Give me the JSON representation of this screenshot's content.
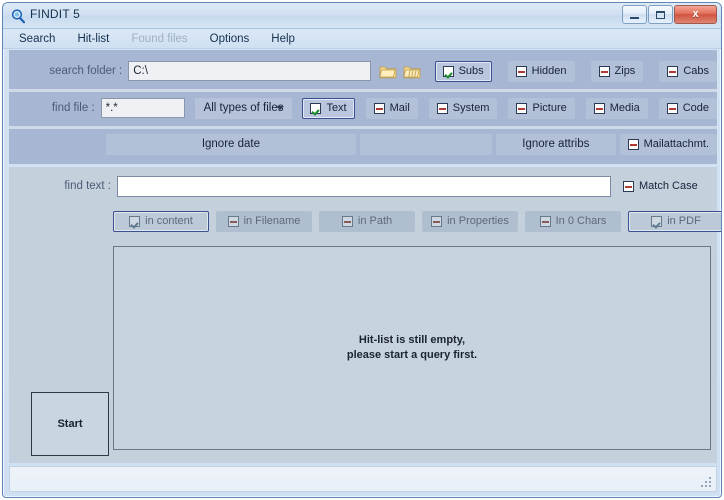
{
  "window": {
    "title": "FINDIT  5",
    "icon": "magnifier-icon",
    "minimize_label": "",
    "maximize_label": "",
    "close_label": "x"
  },
  "menubar": {
    "items": [
      {
        "label": "Search",
        "disabled": false
      },
      {
        "label": "Hit-list",
        "disabled": false
      },
      {
        "label": "Found files",
        "disabled": true
      },
      {
        "label": "Options",
        "disabled": false
      },
      {
        "label": "Help",
        "disabled": false
      }
    ]
  },
  "search_folder_row": {
    "label": "search folder :",
    "value": "C:\\",
    "placeholder": "",
    "browse_folder_icon": "folder-icon",
    "browse_folders_icon": "multi-folder-icon",
    "options": [
      {
        "label": "Subs",
        "checked": true
      },
      {
        "label": "Hidden",
        "checked": false
      },
      {
        "label": "Zips",
        "checked": false
      },
      {
        "label": "Cabs",
        "checked": false
      }
    ]
  },
  "find_file_row": {
    "label": "find file :",
    "value": "*.*",
    "placeholder": "",
    "filetype_selected": "All types of files",
    "options": [
      {
        "label": "Text",
        "checked": true
      },
      {
        "label": "Mail",
        "checked": false
      },
      {
        "label": "System",
        "checked": false
      },
      {
        "label": "Picture",
        "checked": false
      },
      {
        "label": "Media",
        "checked": false
      },
      {
        "label": "Code",
        "checked": false
      }
    ]
  },
  "ignore_row": {
    "ignore_date_label": "Ignore date",
    "ignore_attribs_label": "Ignore attribs",
    "mailattachment": {
      "label": "Mailattachmt.",
      "checked": false
    }
  },
  "find_text_row": {
    "label": "find text :",
    "value": "",
    "placeholder": "",
    "match_case": {
      "label": "Match Case",
      "checked": false
    }
  },
  "scope_buttons": [
    {
      "label": "in content",
      "checked": true
    },
    {
      "label": "in Filename",
      "checked": false
    },
    {
      "label": "in Path",
      "checked": false
    },
    {
      "label": "in Properties",
      "checked": false
    },
    {
      "label": "In 0 Chars",
      "checked": false
    },
    {
      "label": "in PDF",
      "checked": true
    }
  ],
  "results": {
    "empty_message": "Hit-list is still empty,\nplease start a query first."
  },
  "start_button": {
    "label": "Start"
  },
  "statusbar": {
    "text": ""
  },
  "colors": {
    "panel_top": "#a7b6d2",
    "panel_bottom": "#c4d1dd",
    "window_chrome": "#cfe0f2",
    "accent_border": "#3b4f91",
    "check_green": "#1a8a2a",
    "dash_red": "#b03a34",
    "folder_yellow": "#f0d080",
    "results_border": "#6d7885"
  }
}
